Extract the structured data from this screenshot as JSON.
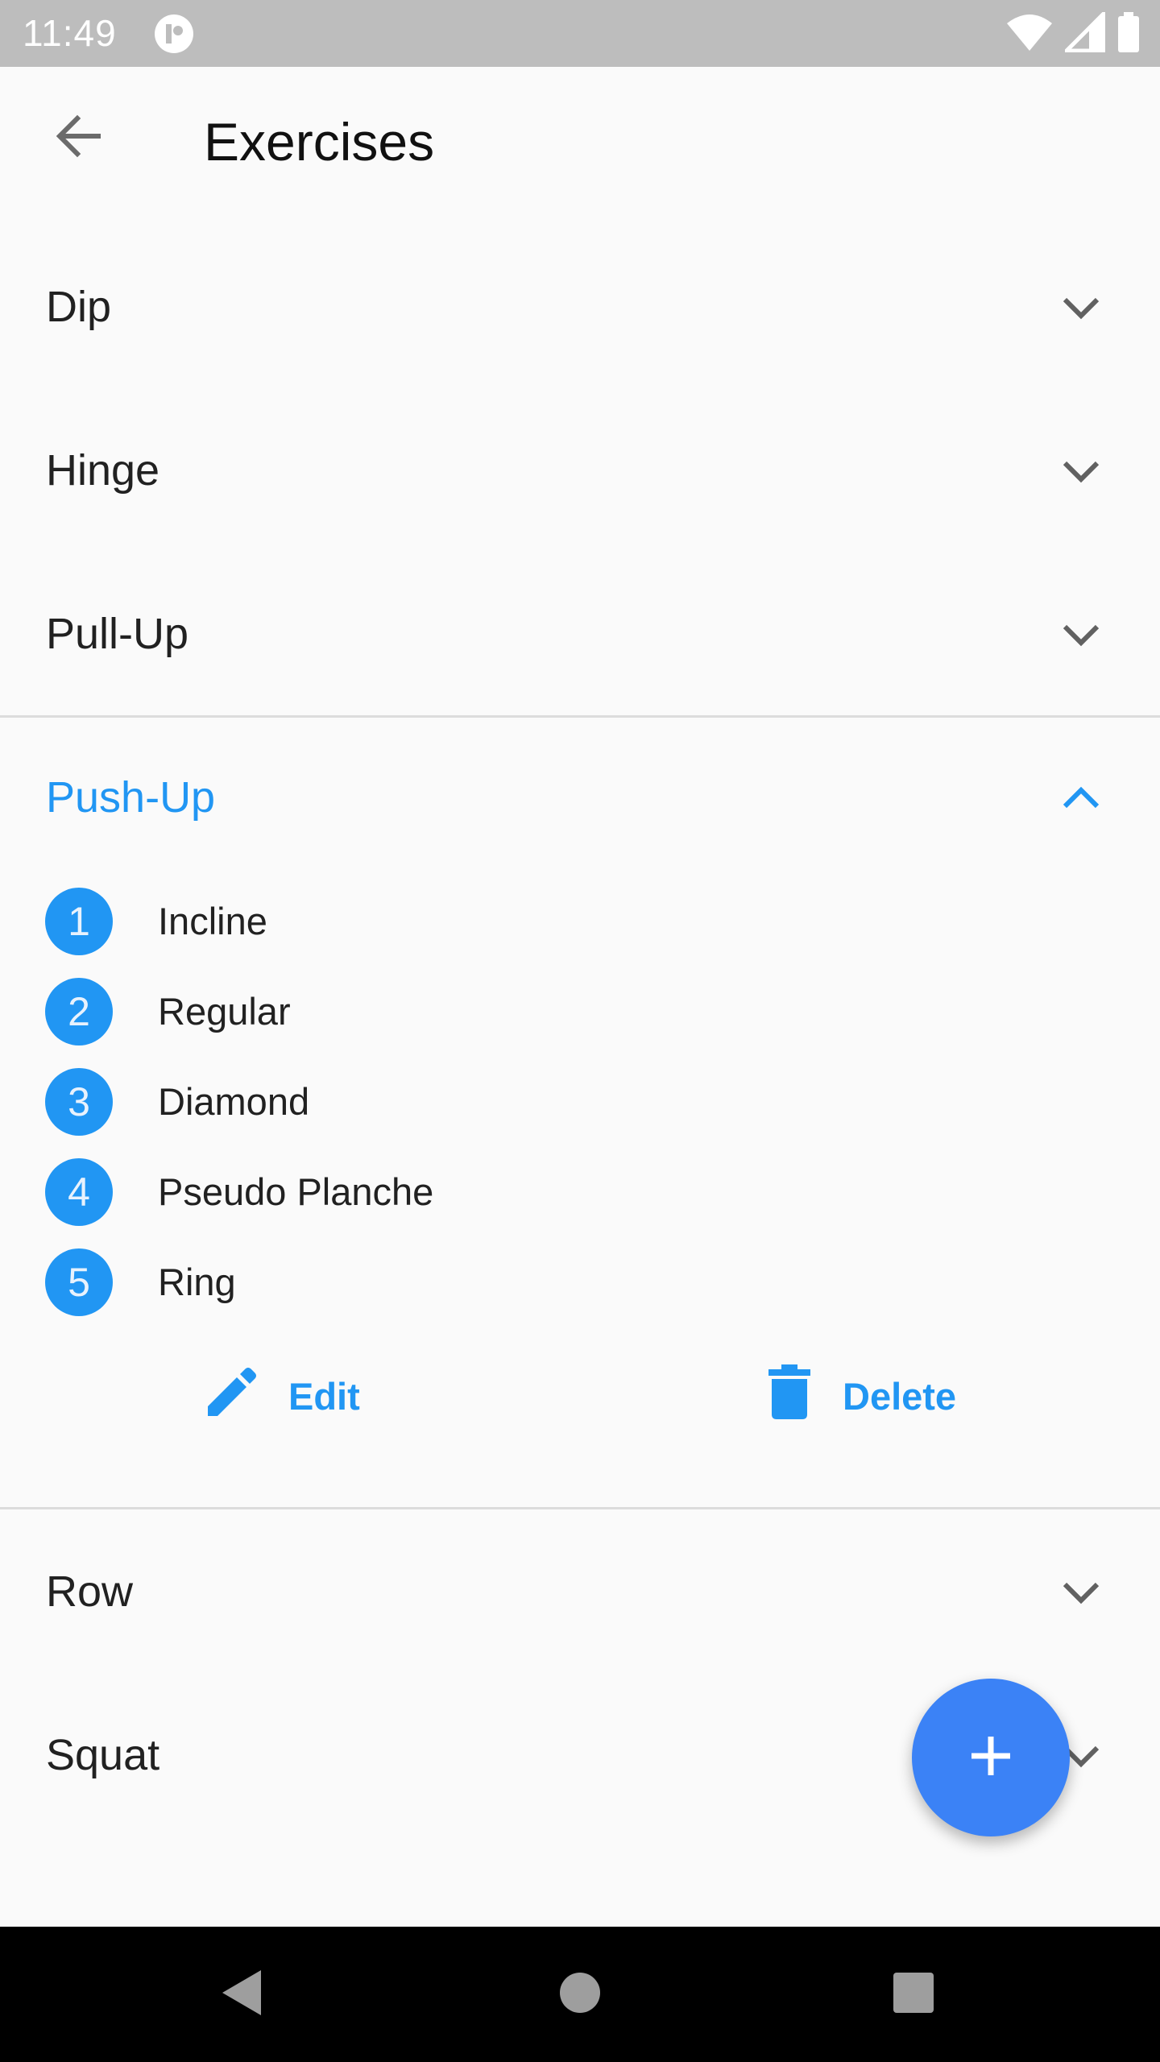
{
  "status_bar": {
    "time": "11:49",
    "icons": [
      "app-notification-icon",
      "wifi-icon",
      "signal-icon",
      "battery-icon"
    ]
  },
  "app_bar": {
    "title": "Exercises",
    "back_icon": "arrow-back-icon"
  },
  "categories": [
    {
      "label": "Dip",
      "expanded": false
    },
    {
      "label": "Hinge",
      "expanded": false
    },
    {
      "label": "Pull-Up",
      "expanded": false
    },
    {
      "label": "Push-Up",
      "expanded": true
    },
    {
      "label": "Row",
      "expanded": false
    },
    {
      "label": "Squat",
      "expanded": false
    }
  ],
  "expanded_section": {
    "items": [
      {
        "number": "1",
        "label": "Incline"
      },
      {
        "number": "2",
        "label": "Regular"
      },
      {
        "number": "3",
        "label": "Diamond"
      },
      {
        "number": "4",
        "label": "Pseudo Planche"
      },
      {
        "number": "5",
        "label": "Ring"
      }
    ],
    "edit_label": "Edit",
    "delete_label": "Delete"
  },
  "fab": {
    "icon": "plus-icon"
  },
  "nav_bar": {
    "icons": [
      "back-triangle-icon",
      "home-circle-icon",
      "recents-square-icon"
    ]
  },
  "colors": {
    "accent": "#2196f3",
    "fab": "#3b82f6",
    "status_bar": "#bdbdbd",
    "background": "#fafafa"
  }
}
